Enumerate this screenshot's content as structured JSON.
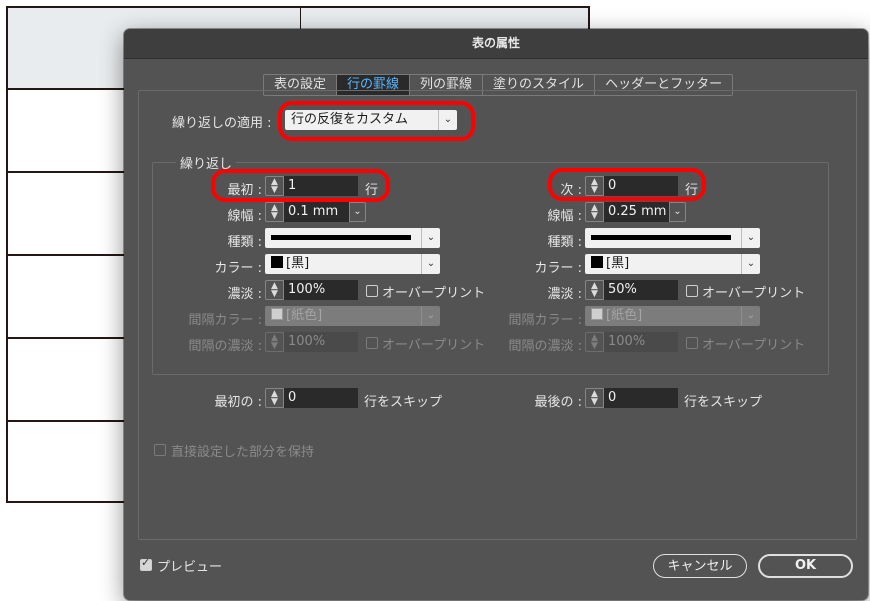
{
  "dialog": {
    "title": "表の属性"
  },
  "tabs": [
    {
      "label": "表の設定"
    },
    {
      "label": "行の罫線"
    },
    {
      "label": "列の罫線"
    },
    {
      "label": "塗りのスタイル"
    },
    {
      "label": "ヘッダーとフッター"
    }
  ],
  "repeat_apply": {
    "label": "繰り返しの適用 :",
    "value": "行の反復をカスタム"
  },
  "repeat_group": {
    "title": "繰り返し"
  },
  "first": {
    "count_label": "最初 :",
    "count_value": "1",
    "count_unit": "行",
    "weight_label": "線幅 :",
    "weight_value": "0.1 mm",
    "type_label": "種類 :",
    "color_label": "カラー :",
    "color_value": "[黒]",
    "tint_label": "濃淡 :",
    "tint_value": "100%",
    "overprint_label": "オーバープリント",
    "gap_color_label": "間隔カラー :",
    "gap_color_value": "[紙色]",
    "gap_tint_label": "間隔の濃淡 :",
    "gap_tint_value": "100%",
    "gap_overprint_label": "オーバープリント"
  },
  "next": {
    "count_label": "次 :",
    "count_value": "0",
    "count_unit": "行",
    "weight_label": "線幅 :",
    "weight_value": "0.25 mm",
    "type_label": "種類 :",
    "color_label": "カラー :",
    "color_value": "[黒]",
    "tint_label": "濃淡 :",
    "tint_value": "50%",
    "overprint_label": "オーバープリント",
    "gap_color_label": "間隔カラー :",
    "gap_color_value": "[紙色]",
    "gap_tint_label": "間隔の濃淡 :",
    "gap_tint_value": "100%",
    "gap_overprint_label": "オーバープリント"
  },
  "skip": {
    "first_label": "最初の :",
    "first_value": "0",
    "last_label": "最後の :",
    "last_value": "0",
    "unit": "行をスキップ"
  },
  "preserve_local": {
    "label": "直接設定した部分を保持"
  },
  "preview": {
    "label": "プレビュー"
  },
  "buttons": {
    "cancel": "キャンセル",
    "ok": "OK"
  },
  "colors": {
    "accent": "#5cb8ff",
    "highlight": "#ff0000",
    "dialog_bg": "#535353"
  }
}
